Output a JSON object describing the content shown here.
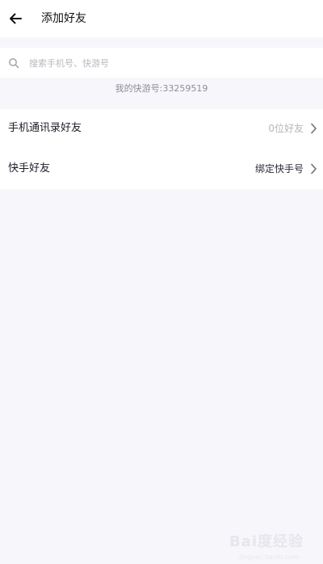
{
  "header": {
    "title": "添加好友",
    "back_icon": "arrow-left-icon"
  },
  "search": {
    "placeholder": "搜索手机号、快游号",
    "value": "",
    "icon": "search-icon"
  },
  "my_id": {
    "text": "我的快游号:33259519"
  },
  "rows": [
    {
      "label": "手机通讯录好友",
      "value": "0位好友",
      "value_color": "#b5b5bd",
      "icon": "chevron-right-icon"
    },
    {
      "label": "快手好友",
      "value": "绑定快手号",
      "value_color": "#2a2a36",
      "icon": "chevron-right-icon"
    }
  ],
  "watermark": {
    "text": "Bai度经验",
    "url": "jingyan.baidu.com"
  },
  "colors": {
    "page_bg": "#f7f7fb",
    "card_bg": "#ffffff",
    "muted_text": "#8d8d99",
    "placeholder": "#b8b8c0"
  }
}
